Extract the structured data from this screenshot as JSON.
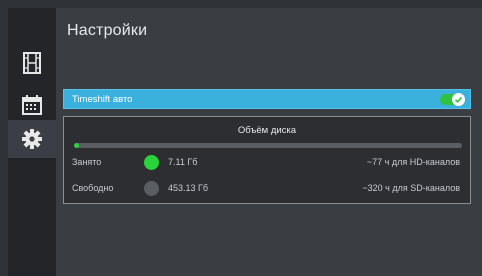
{
  "page": {
    "title": "Настройки"
  },
  "sidebar": {
    "items": [
      {
        "icon": "film-icon"
      },
      {
        "icon": "calendar-icon"
      },
      {
        "icon": "gear-icon",
        "active": true
      }
    ]
  },
  "timeshift": {
    "label": "Timeshift авто",
    "enabled": true
  },
  "disk": {
    "title": "Объём диска",
    "used_fraction": 0.012,
    "used": {
      "label": "Занято",
      "size": "7.11 Гб",
      "duration": "~77 ч для HD-каналов",
      "color": "#2ad33a"
    },
    "free": {
      "label": "Свободно",
      "size": "453.13 Гб",
      "duration": "~320 ч для SD-каналов",
      "color": "#5a5d62"
    }
  },
  "colors": {
    "accent": "#3ab0dd",
    "toggle_on": "#2ec23e"
  }
}
